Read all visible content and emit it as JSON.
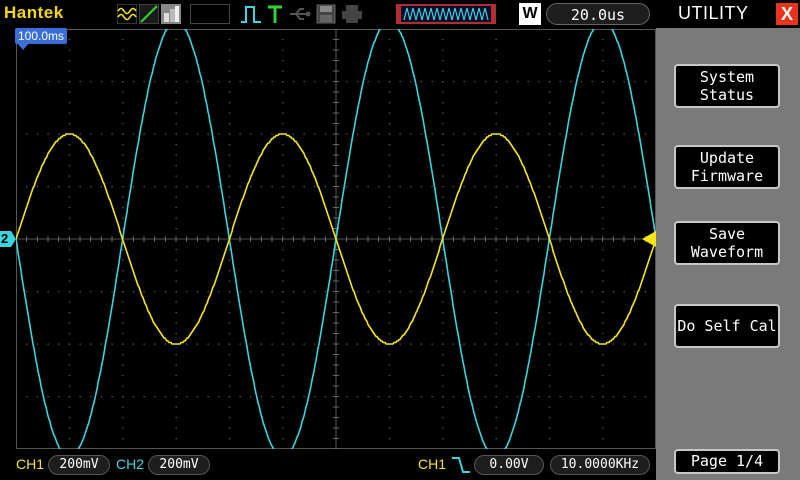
{
  "brand": "Hantek",
  "timebase": {
    "mode_label": "W",
    "value": "20.0us"
  },
  "trigger_delay": "100.0ms",
  "channel_marker": "2",
  "menu": {
    "title": "UTILITY",
    "close_label": "X",
    "buttons": [
      {
        "line1": "System",
        "line2": "Status"
      },
      {
        "line1": "Update",
        "line2": "Firmware"
      },
      {
        "line1": "Save",
        "line2": "Waveform"
      },
      {
        "line1": "Do Self Cal",
        "line2": ""
      }
    ],
    "page": "Page 1/4"
  },
  "status": {
    "ch1_label": "CH1",
    "ch1_scale": "200mV",
    "ch2_label": "CH2",
    "ch2_scale": "200mV",
    "trig_source": "CH1",
    "trig_level": "0.00V",
    "frequency": "10.0000KHz"
  },
  "colors": {
    "ch1": "#f5e614",
    "ch2": "#38d6e0",
    "brand": "#f5d800",
    "grid": "#6a6a6a",
    "menu_bg": "#7a7a7a",
    "accent_red": "#e8341c"
  },
  "waveforms": [
    {
      "channel": "CH1",
      "shape": "sine",
      "amplitude_divisions": 2.0,
      "cycles_on_screen": 3.0
    },
    {
      "channel": "CH2",
      "shape": "sine",
      "amplitude_divisions": 4.15,
      "cycles_on_screen": 3.0
    }
  ]
}
